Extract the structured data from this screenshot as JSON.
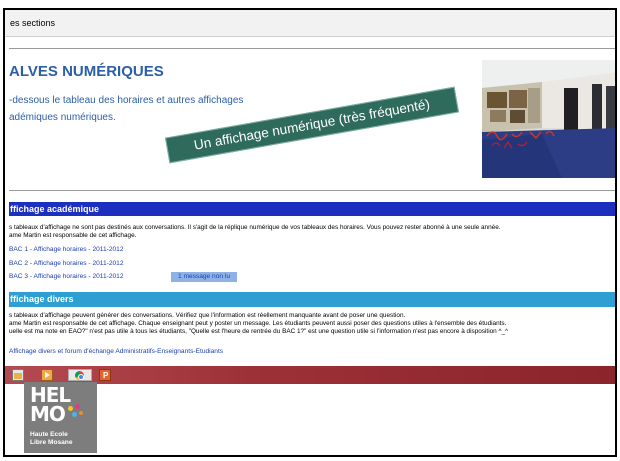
{
  "header": {
    "title": "es sections"
  },
  "hero": {
    "title": "ALVES NUMÉRIQUES",
    "intro_line1": "-dessous le tableau des horaires et autres affichages",
    "intro_line2": "adémiques numériques.",
    "banner": "Un affichage numérique (très fréquenté)"
  },
  "academic": {
    "heading": "ffichage académique",
    "line1": "s tableaux d'affichage ne sont pas destinés aux conversations. Il s'agit de la réplique numérique de vos tableaux des horaires. Vous pouvez rester abonné à une seule année.",
    "line2": "ame Martin est responsable de cet affichage.",
    "links": [
      "BAC 1 - Affichage horaires - 2011-2012",
      "BAC 2 - Affichage horaires - 2011-2012",
      "BAC 3 - Affichage horaires - 2011-2012"
    ],
    "unread_badge": "1 message non lu"
  },
  "misc": {
    "heading": "ffichage divers",
    "line1": "s tableaux d'affichage peuvent générer des conversations. Vérifiez que l'information est réellement manquante avant de poser une question.",
    "line2": "ame Martin est responsable de cet affichage. Chaque enseignant peut y poster un message. Les étudiants peuvent aussi poser des questions utiles à l'ensemble des étudiants.",
    "line3": "uelle est ma note en EAO?\" n'est pas utile à tous les étudiants, \"Quelle est l'heure de rentrée du BAC 1?\" est une question utile si l'information n'est pas encore à disposition ^_^",
    "link": "Affichage divers et forum d'échange Administratifs-Enseignants-Etudiants"
  },
  "logo": {
    "big1": "HEL",
    "big2": "MO",
    "small1": "Haute Ecole",
    "small2": "Libre Mosane"
  },
  "colors": {
    "link": "#1b3fb0",
    "title": "#2c5fa6",
    "academic_bar": "#1c2fbf",
    "misc_bar": "#2d9fd3",
    "taskbar": "#9d3138",
    "banner": "#2f6b5c"
  },
  "icons": [
    "folder-icon",
    "media-player-icon",
    "chrome-icon",
    "powerpoint-icon"
  ]
}
